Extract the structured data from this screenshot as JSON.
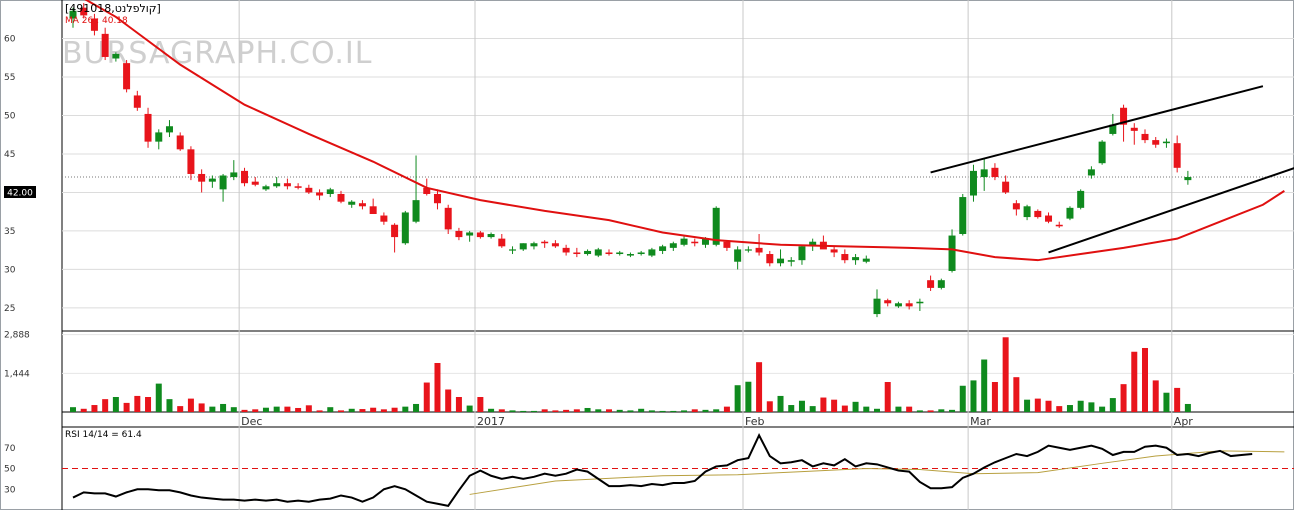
{
  "header": {
    "title": "[קולפלנט,491018]",
    "ma_label": "MA 26 : 40.18",
    "rsi_label": "RSI 14/14 = 61.4",
    "watermark": "BURSAGRAPH.CO.IL",
    "last_price": "42.00"
  },
  "colors": {
    "up": "#0f8a1e",
    "down": "#e8141b",
    "ma": "#e01010",
    "trend": "#000000",
    "rsi": "#000000",
    "rsi_signal": "#b8a040",
    "rsi_ref": "#e01010"
  },
  "chart_data": [
    {
      "type": "candlestick",
      "price_ticks": [
        "60",
        "55",
        "50",
        "45",
        "40",
        "35",
        "30",
        "25"
      ],
      "price_tick_values": [
        60,
        55,
        50,
        45,
        40,
        35,
        30,
        25
      ],
      "ylim": [
        22,
        65
      ],
      "x_labels": [
        "Dec",
        "2017",
        "Feb",
        "Mar",
        "Apr"
      ],
      "x_label_index": [
        16,
        38,
        63,
        84,
        103
      ],
      "last_price": 42.0,
      "candles": [
        [
          62.6,
          64.0,
          61.4,
          63.6
        ],
        [
          64.0,
          64.6,
          62.6,
          63.0
        ],
        [
          62.6,
          63.2,
          60.4,
          61.0
        ],
        [
          60.6,
          61.4,
          57.2,
          57.6
        ],
        [
          57.4,
          58.2,
          57.0,
          58.0
        ],
        [
          56.8,
          57.2,
          53.0,
          53.4
        ],
        [
          52.6,
          53.2,
          50.6,
          51.0
        ],
        [
          50.2,
          51.0,
          45.8,
          46.6
        ],
        [
          46.6,
          48.2,
          45.6,
          47.8
        ],
        [
          47.8,
          49.4,
          47.2,
          48.6
        ],
        [
          47.4,
          47.8,
          45.4,
          45.6
        ],
        [
          45.6,
          46.0,
          41.6,
          42.4
        ],
        [
          42.4,
          43.0,
          40.0,
          41.4
        ],
        [
          41.4,
          42.2,
          40.6,
          41.8
        ],
        [
          40.4,
          42.4,
          38.8,
          42.2
        ],
        [
          42.0,
          44.2,
          41.6,
          42.6
        ],
        [
          42.8,
          43.2,
          40.8,
          41.2
        ],
        [
          41.4,
          42.0,
          40.8,
          41.0
        ],
        [
          40.4,
          41.0,
          40.2,
          40.8
        ],
        [
          40.8,
          42.0,
          40.6,
          41.2
        ],
        [
          41.2,
          41.8,
          40.4,
          40.8
        ],
        [
          40.8,
          41.2,
          40.4,
          40.6
        ],
        [
          40.6,
          41.0,
          39.8,
          40.0
        ],
        [
          40.0,
          40.4,
          39.0,
          39.6
        ],
        [
          39.8,
          40.6,
          39.4,
          40.4
        ],
        [
          39.8,
          40.2,
          38.6,
          38.8
        ],
        [
          38.4,
          39.0,
          38.0,
          38.8
        ],
        [
          38.6,
          39.0,
          37.8,
          38.2
        ],
        [
          38.2,
          39.2,
          37.6,
          37.2
        ],
        [
          37.0,
          37.4,
          35.8,
          36.2
        ],
        [
          35.8,
          36.0,
          32.2,
          34.2
        ],
        [
          33.4,
          37.6,
          33.2,
          37.4
        ],
        [
          36.2,
          44.8,
          36.0,
          39.0
        ],
        [
          40.6,
          41.8,
          39.6,
          39.8
        ],
        [
          39.8,
          40.4,
          37.8,
          38.6
        ],
        [
          38.0,
          38.4,
          34.6,
          35.2
        ],
        [
          35.0,
          35.4,
          33.8,
          34.2
        ],
        [
          34.4,
          35.0,
          33.6,
          34.8
        ],
        [
          34.8,
          35.0,
          34.0,
          34.2
        ],
        [
          34.2,
          34.8,
          34.0,
          34.6
        ],
        [
          34.0,
          34.6,
          32.8,
          33.0
        ],
        [
          32.6,
          33.0,
          32.0,
          32.6
        ],
        [
          32.6,
          33.4,
          32.4,
          33.4
        ],
        [
          33.0,
          33.6,
          32.6,
          33.4
        ],
        [
          33.6,
          33.8,
          32.8,
          33.4
        ],
        [
          33.4,
          33.8,
          32.8,
          33.0
        ],
        [
          32.8,
          33.2,
          31.8,
          32.2
        ],
        [
          32.2,
          32.8,
          31.6,
          32.0
        ],
        [
          32.0,
          32.6,
          31.8,
          32.4
        ],
        [
          31.8,
          32.8,
          31.6,
          32.6
        ],
        [
          32.2,
          32.6,
          31.8,
          32.0
        ],
        [
          32.0,
          32.4,
          31.8,
          32.2
        ],
        [
          31.8,
          32.2,
          31.6,
          32.0
        ],
        [
          32.0,
          32.4,
          31.8,
          32.2
        ],
        [
          31.8,
          32.8,
          31.6,
          32.6
        ],
        [
          32.4,
          33.2,
          32.0,
          33.0
        ],
        [
          32.8,
          33.6,
          32.4,
          33.4
        ],
        [
          33.2,
          34.4,
          33.0,
          34.0
        ],
        [
          33.6,
          34.0,
          33.0,
          33.4
        ],
        [
          33.2,
          34.2,
          32.8,
          34.0
        ],
        [
          33.2,
          38.2,
          33.0,
          38.0
        ],
        [
          33.6,
          33.8,
          32.4,
          32.8
        ],
        [
          31.0,
          33.0,
          30.0,
          32.6
        ],
        [
          32.6,
          33.0,
          32.2,
          32.6
        ],
        [
          32.8,
          34.6,
          31.8,
          32.2
        ],
        [
          32.0,
          32.4,
          30.4,
          30.8
        ],
        [
          30.8,
          32.6,
          30.4,
          31.4
        ],
        [
          31.0,
          31.6,
          30.4,
          31.2
        ],
        [
          31.2,
          33.2,
          30.6,
          33.0
        ],
        [
          33.0,
          34.0,
          32.4,
          33.6
        ],
        [
          33.6,
          34.4,
          32.8,
          32.6
        ],
        [
          32.6,
          33.0,
          31.6,
          32.2
        ],
        [
          32.0,
          32.6,
          30.8,
          31.2
        ],
        [
          31.2,
          32.0,
          30.6,
          31.6
        ],
        [
          31.0,
          31.8,
          30.8,
          31.4
        ],
        [
          24.2,
          27.4,
          23.8,
          26.2
        ],
        [
          26.0,
          26.2,
          25.2,
          25.6
        ],
        [
          25.2,
          25.8,
          25.0,
          25.6
        ],
        [
          25.6,
          26.0,
          24.8,
          25.2
        ],
        [
          25.6,
          26.2,
          24.6,
          25.8
        ],
        [
          28.6,
          29.2,
          27.2,
          27.6
        ],
        [
          27.6,
          28.8,
          27.4,
          28.6
        ],
        [
          29.8,
          35.2,
          29.6,
          34.4
        ],
        [
          34.6,
          39.8,
          34.4,
          39.4
        ],
        [
          39.6,
          43.6,
          38.8,
          42.8
        ],
        [
          42.0,
          44.4,
          40.2,
          43.0
        ],
        [
          43.2,
          43.8,
          41.6,
          42.0
        ],
        [
          41.4,
          42.2,
          39.8,
          40.0
        ],
        [
          38.6,
          39.0,
          37.0,
          37.8
        ],
        [
          36.8,
          38.4,
          36.4,
          38.2
        ],
        [
          37.6,
          37.8,
          36.6,
          36.8
        ],
        [
          37.0,
          37.4,
          36.0,
          36.2
        ],
        [
          35.8,
          36.2,
          35.4,
          35.6
        ],
        [
          36.6,
          38.2,
          36.4,
          38.0
        ],
        [
          38.0,
          40.4,
          37.8,
          40.2
        ],
        [
          42.2,
          43.4,
          41.8,
          43.0
        ],
        [
          43.8,
          46.8,
          43.6,
          46.6
        ],
        [
          47.6,
          50.2,
          47.4,
          48.8
        ],
        [
          51.0,
          51.4,
          46.6,
          48.8
        ],
        [
          48.4,
          49.0,
          46.2,
          48.0
        ],
        [
          47.6,
          48.2,
          46.4,
          46.8
        ],
        [
          46.8,
          47.2,
          45.8,
          46.2
        ],
        [
          46.4,
          47.0,
          45.8,
          46.6
        ],
        [
          46.4,
          47.4,
          42.6,
          43.2
        ],
        [
          41.6,
          42.8,
          41.0,
          42.0
        ]
      ],
      "ma26": [
        [
          0,
          66.0
        ],
        [
          4,
          62.8
        ],
        [
          10,
          56.6
        ],
        [
          16,
          51.4
        ],
        [
          22,
          47.6
        ],
        [
          28,
          44.0
        ],
        [
          33,
          40.6
        ],
        [
          38,
          39.0
        ],
        [
          44,
          37.6
        ],
        [
          50,
          36.4
        ],
        [
          55,
          34.8
        ],
        [
          60,
          33.8
        ],
        [
          66,
          33.2
        ],
        [
          72,
          33.0
        ],
        [
          78,
          32.8
        ],
        [
          82,
          32.6
        ],
        [
          86,
          31.6
        ],
        [
          90,
          31.2
        ],
        [
          94,
          32.0
        ],
        [
          98,
          32.8
        ],
        [
          103,
          34.0
        ],
        [
          107,
          36.2
        ],
        [
          111,
          38.4
        ],
        [
          113,
          40.2
        ]
      ],
      "trendlines": [
        [
          [
            80,
            42.6
          ],
          [
            111,
            53.8
          ]
        ],
        [
          [
            91,
            32.2
          ],
          [
            114,
            43.2
          ]
        ]
      ],
      "volume": [
        180,
        120,
        260,
        480,
        560,
        340,
        600,
        560,
        1060,
        480,
        220,
        500,
        320,
        200,
        300,
        180,
        80,
        100,
        160,
        200,
        200,
        150,
        250,
        60,
        180,
        60,
        120,
        110,
        160,
        100,
        160,
        200,
        300,
        1100,
        1830,
        840,
        560,
        240,
        560,
        120,
        100,
        60,
        40,
        40,
        100,
        60,
        80,
        100,
        150,
        100,
        100,
        80,
        60,
        120,
        60,
        40,
        40,
        60,
        100,
        80,
        100,
        200,
        1000,
        1130,
        1860,
        400,
        600,
        260,
        420,
        220,
        540,
        460,
        240,
        380,
        200,
        120,
        1120,
        200,
        200,
        60,
        60,
        100,
        80,
        980,
        1180,
        1960,
        1120,
        2790,
        1300,
        460,
        500,
        420,
        220,
        260,
        420,
        360,
        200,
        520,
        1040,
        2250,
        2390,
        1180,
        720,
        900,
        300,
        220,
        480,
        80
      ],
      "volume_ticks": [
        "2,888",
        "1,444"
      ],
      "volume_tick_values": [
        2888,
        1444
      ],
      "volume_max": 2950,
      "rsi_ticks": [
        "70",
        "50",
        "30"
      ],
      "rsi_tick_values": [
        70,
        50,
        30
      ],
      "rsi_ylim": [
        10,
        90
      ],
      "rsi_reference": 50,
      "rsi": [
        22,
        27,
        26,
        26,
        23,
        27,
        30,
        30,
        29,
        29,
        27,
        24,
        22,
        21,
        20,
        20,
        19,
        20,
        19,
        20,
        18,
        19,
        18,
        20,
        21,
        24,
        22,
        18,
        22,
        30,
        33,
        30,
        24,
        18,
        16,
        14,
        29,
        43,
        48,
        43,
        40,
        42,
        40,
        42,
        45,
        43,
        45,
        49,
        47,
        40,
        33,
        33,
        34,
        33,
        35,
        34,
        36,
        36,
        38,
        47,
        52,
        53,
        58,
        60,
        82,
        62,
        55,
        56,
        58,
        52,
        55,
        53,
        59,
        52,
        55,
        54,
        51,
        48,
        47,
        37,
        31,
        31,
        32,
        41,
        45,
        51,
        56,
        60,
        64,
        62,
        66,
        72,
        70,
        68,
        70,
        72,
        69,
        63,
        66,
        66,
        71,
        72,
        70,
        63,
        64,
        62,
        65,
        67,
        62,
        63,
        64
      ],
      "rsi_signal": [
        [
          37,
          25
        ],
        [
          45,
          38
        ],
        [
          55,
          43
        ],
        [
          62,
          44
        ],
        [
          68,
          47
        ],
        [
          74,
          50
        ],
        [
          79,
          49
        ],
        [
          84,
          45
        ],
        [
          90,
          46
        ],
        [
          96,
          55
        ],
        [
          101,
          62
        ],
        [
          107,
          67
        ],
        [
          113,
          66
        ]
      ]
    }
  ]
}
